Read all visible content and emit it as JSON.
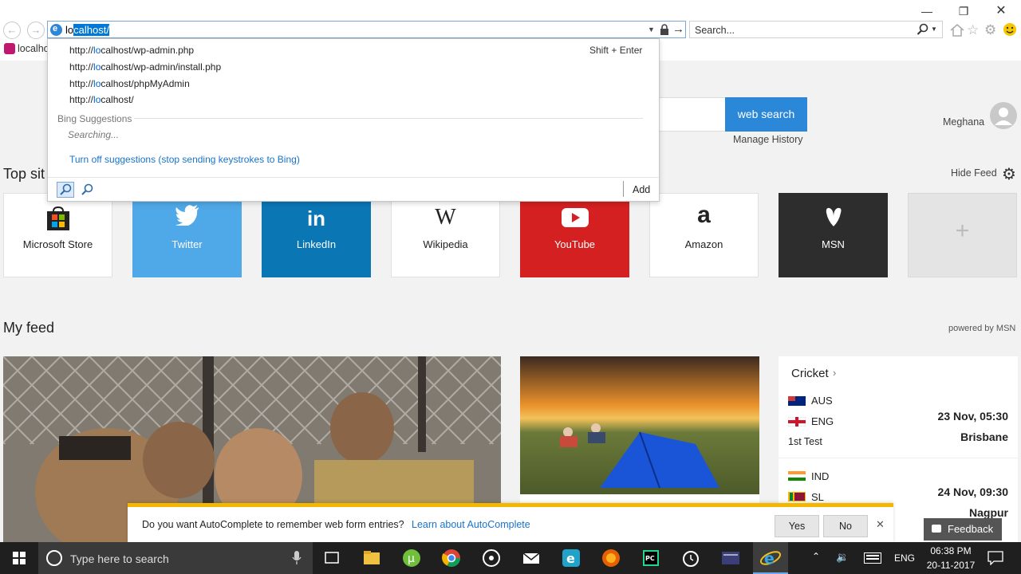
{
  "browser": {
    "address_typed": "lo",
    "address_selected": "calhost/",
    "search_placeholder": "Search...",
    "tab_label": "localho"
  },
  "dropdown": {
    "history": [
      {
        "pre": "http://",
        "hl": "lo",
        "post": "calhost/wp-admin.php"
      },
      {
        "pre": "http://",
        "hl": "lo",
        "post": "calhost/wp-admin/install.php"
      },
      {
        "pre": "http://",
        "hl": "lo",
        "post": "calhost/phpMyAdmin"
      },
      {
        "pre": "http://",
        "hl": "lo",
        "post": "calhost/"
      }
    ],
    "shortcut": "Shift + Enter",
    "bing_header": "Bing Suggestions",
    "searching": "Searching...",
    "turn_off": "Turn off suggestions (stop sending keystrokes to Bing)",
    "add": "Add"
  },
  "page": {
    "web_search": "web search",
    "user": "Meghana",
    "manage_history": "Manage History",
    "top_sites": "Top sit",
    "hide_feed": "Hide Feed",
    "my_feed": "My feed",
    "powered_by": "powered by MSN"
  },
  "tiles": [
    {
      "label": "Microsoft Store",
      "color": "#ffffff",
      "text": "#222222"
    },
    {
      "label": "Twitter",
      "color": "#4fa8e8",
      "text": "#ffffff"
    },
    {
      "label": "LinkedIn",
      "color": "#0a76b4",
      "text": "#ffffff"
    },
    {
      "label": "Wikipedia",
      "color": "#ffffff",
      "text": "#222222"
    },
    {
      "label": "YouTube",
      "color": "#d42020",
      "text": "#ffffff"
    },
    {
      "label": "Amazon",
      "color": "#ffffff",
      "text": "#222222"
    },
    {
      "label": "MSN",
      "color": "#2d2d2d",
      "text": "#ffffff"
    }
  ],
  "cricket": {
    "title": "Cricket",
    "match1": {
      "team1": "AUS",
      "team2": "ENG",
      "label": "1st Test",
      "date": "23 Nov, 05:30",
      "venue": "Brisbane"
    },
    "match2": {
      "team1": "IND",
      "team2": "SL",
      "date": "24 Nov, 09:30",
      "venue": "Nagpur"
    }
  },
  "autocomplete": {
    "question": "Do you want AutoComplete to remember web form entries?",
    "learn": "Learn about AutoComplete",
    "yes": "Yes",
    "no": "No",
    "feedback": "Feedback"
  },
  "taskbar": {
    "search_placeholder": "Type here to search",
    "lang": "ENG",
    "time": "06:38 PM",
    "date": "20-11-2017"
  },
  "colors": {
    "accent": "#0078d7",
    "autocomplete_bar": "#f4b700"
  }
}
